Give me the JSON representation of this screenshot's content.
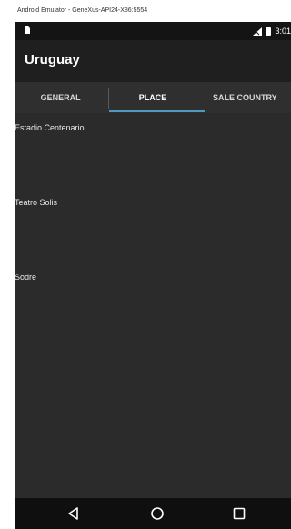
{
  "window": {
    "title": "Android Emulator - GeneXus-API24-X86:5554"
  },
  "status_bar": {
    "time": "3:01",
    "icons": [
      "sim-card-icon",
      "signal-icon",
      "battery-icon"
    ]
  },
  "app_bar": {
    "title": "Uruguay"
  },
  "tabs": [
    {
      "label": "GENERAL",
      "selected": false
    },
    {
      "label": "PLACE",
      "selected": true
    },
    {
      "label": "SALE COUNTRY",
      "selected": false
    }
  ],
  "places": [
    {
      "name": "Estadio Centenario"
    },
    {
      "name": "Teatro Solis"
    },
    {
      "name": "Sodre"
    }
  ],
  "nav": {
    "icons": [
      "back-icon",
      "home-icon",
      "recents-icon"
    ]
  },
  "colors": {
    "tab_indicator": "#4d9cc0",
    "app_bar": "#1f1f1f",
    "background": "#2b2b2b"
  }
}
